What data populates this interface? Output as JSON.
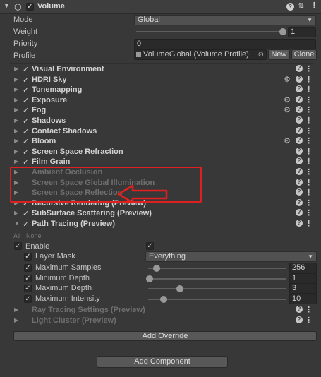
{
  "header": {
    "title": "Volume",
    "icons": [
      "cube-icon",
      "help-icon",
      "sliders-icon",
      "menu-icon"
    ]
  },
  "main": {
    "mode": {
      "label": "Mode",
      "value": "Global"
    },
    "weight": {
      "label": "Weight",
      "value": "1",
      "level": 1.0
    },
    "priority": {
      "label": "Priority",
      "value": "0"
    },
    "profile": {
      "label": "Profile",
      "value": "VolumeGlobal (Volume Profile)",
      "new_label": "New",
      "clone_label": "Clone"
    }
  },
  "overrides": [
    {
      "name": "Visual Environment",
      "enabled": true,
      "gear": false
    },
    {
      "name": "HDRI Sky",
      "enabled": true,
      "gear": true
    },
    {
      "name": "Tonemapping",
      "enabled": true,
      "gear": false
    },
    {
      "name": "Exposure",
      "enabled": true,
      "gear": true
    },
    {
      "name": "Fog",
      "enabled": true,
      "gear": true
    },
    {
      "name": "Shadows",
      "enabled": true,
      "gear": false
    },
    {
      "name": "Contact Shadows",
      "enabled": true,
      "gear": false
    },
    {
      "name": "Bloom",
      "enabled": true,
      "gear": true
    },
    {
      "name": "Screen Space Refraction",
      "enabled": true,
      "gear": false
    },
    {
      "name": "Film Grain",
      "enabled": true,
      "gear": false
    },
    {
      "name": "Ambient Occlusion",
      "enabled": false,
      "gear": false
    },
    {
      "name": "Screen Space Global Illumination",
      "enabled": false,
      "gear": false
    },
    {
      "name": "Screen Space Reflection",
      "enabled": false,
      "gear": false
    },
    {
      "name": "Recursive Rendering (Preview)",
      "enabled": true,
      "gear": false
    },
    {
      "name": "SubSurface Scattering (Preview)",
      "enabled": true,
      "gear": false
    },
    {
      "name": "Path Tracing (Preview)",
      "enabled": true,
      "gear": false
    }
  ],
  "path_tracing": {
    "all_label": "All",
    "none_label": "None",
    "enable_label": "Enable",
    "layer_mask": {
      "label": "Layer Mask",
      "value": "Everything"
    },
    "max_samples": {
      "label": "Maximum Samples",
      "value": "256",
      "level": 0.05
    },
    "min_depth": {
      "label": "Minimum Depth",
      "value": "1",
      "level": 0.0
    },
    "max_depth": {
      "label": "Maximum Depth",
      "value": "3",
      "level": 0.22
    },
    "max_intensity": {
      "label": "Maximum Intensity",
      "value": "10",
      "level": 0.1
    }
  },
  "more_overrides": [
    {
      "name": "Ray Tracing Settings (Preview)"
    },
    {
      "name": "Light Cluster (Preview)"
    }
  ],
  "add_override_label": "Add Override",
  "add_component_label": "Add Component",
  "colors": {
    "annotation": "#e02020",
    "background": "#383838"
  }
}
